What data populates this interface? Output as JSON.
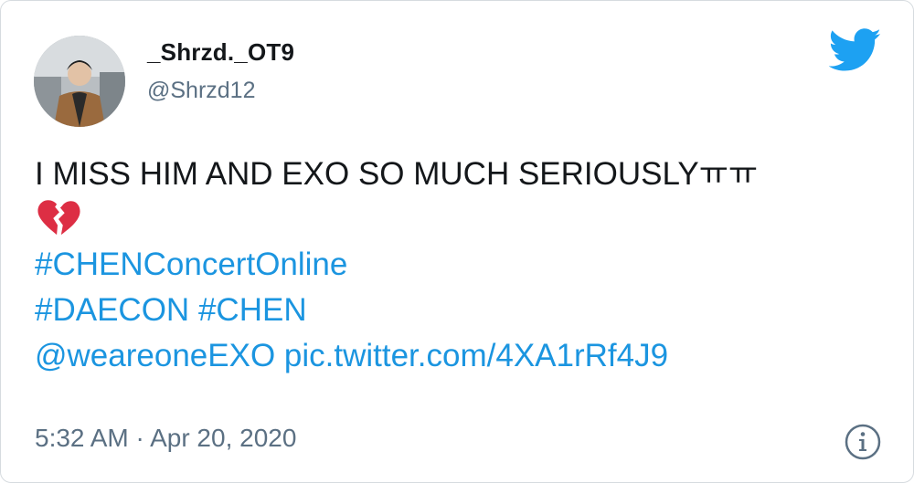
{
  "author": {
    "display_name": "_Shrzd._OT9",
    "handle": "@Shrzd12",
    "avatar_icon": "profile-photo"
  },
  "brand": {
    "icon": "twitter-bird-icon",
    "color": "#1da1f2"
  },
  "tweet": {
    "line1": "I MISS HIM AND EXO SO MUCH SERIOUSLYㅠㅠ",
    "emoji": "broken-heart-icon",
    "hashtag1": "#CHENConcertOnline",
    "hashtag2": "#DAECON",
    "hashtag3": "#CHEN",
    "mention": "@weareoneEXO",
    "link": "pic.twitter.com/4XA1rRf4J9"
  },
  "meta": {
    "time": "5:32 AM",
    "separator": "·",
    "date": "Apr 20, 2020"
  },
  "colors": {
    "link": "#1b95e0",
    "text": "#14171a",
    "secondary": "#5b7083"
  },
  "info_icon": "info-icon"
}
